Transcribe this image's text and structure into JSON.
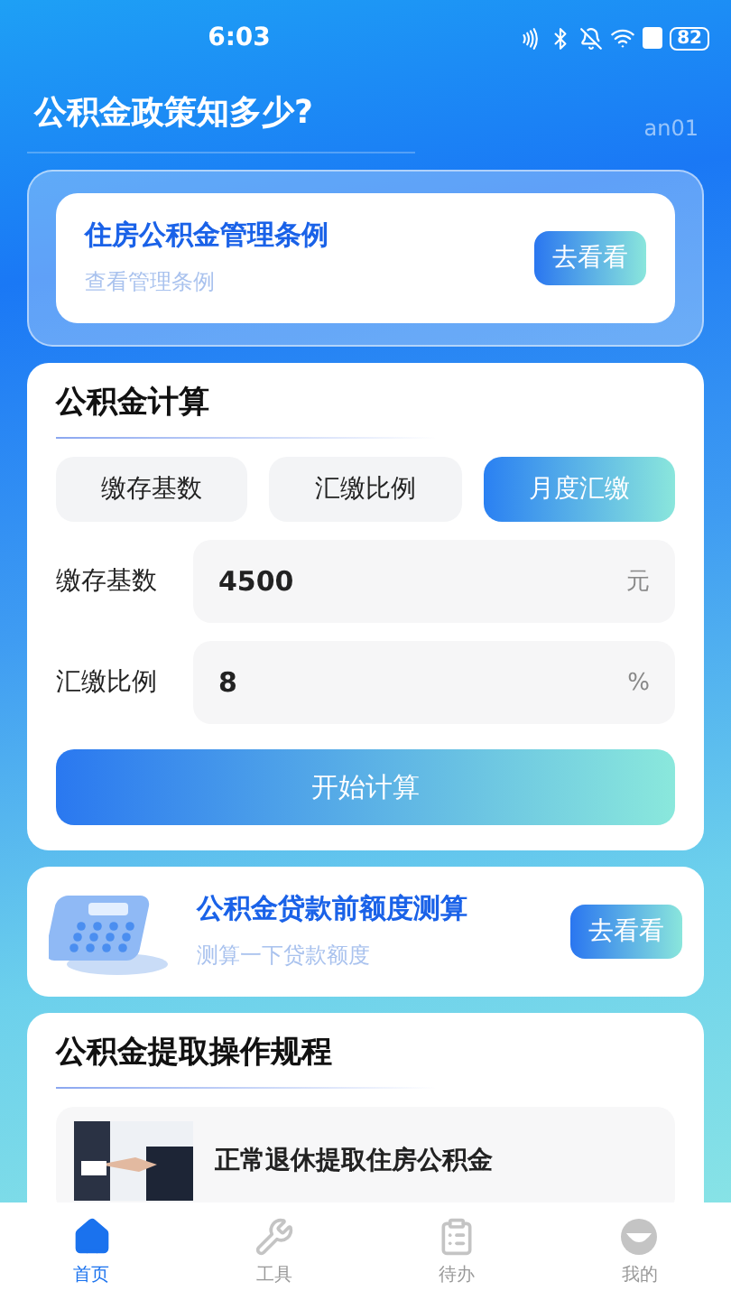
{
  "status_bar": {
    "time": "6:03",
    "battery": "82"
  },
  "header": {
    "title": "公积金政策知多少?",
    "tag": "an01"
  },
  "regulation_card": {
    "title": "住房公积金管理条例",
    "subtitle": "查看管理条例",
    "button": "去看看"
  },
  "calculator": {
    "title": "公积金计算",
    "tabs": [
      {
        "label": "缴存基数",
        "selected": false
      },
      {
        "label": "汇缴比例",
        "selected": false
      },
      {
        "label": "月度汇缴",
        "selected": true
      }
    ],
    "fields": [
      {
        "label": "缴存基数",
        "value": "4500",
        "unit": "元"
      },
      {
        "label": "汇缴比例",
        "value": "8",
        "unit": "%"
      }
    ],
    "button": "开始计算"
  },
  "loan_card": {
    "title": "公积金贷款前额度测算",
    "subtitle": "测算一下贷款额度",
    "button": "去看看"
  },
  "procedures": {
    "title": "公积金提取操作规程",
    "items": [
      {
        "kind": "picture",
        "title": "正常退休提取住房公积金"
      }
    ]
  },
  "tab_bar": [
    {
      "label": "首页",
      "selected": true
    },
    {
      "label": "工具",
      "selected": false
    },
    {
      "label": "待办",
      "selected": false
    },
    {
      "label": "我的",
      "selected": false
    }
  ]
}
